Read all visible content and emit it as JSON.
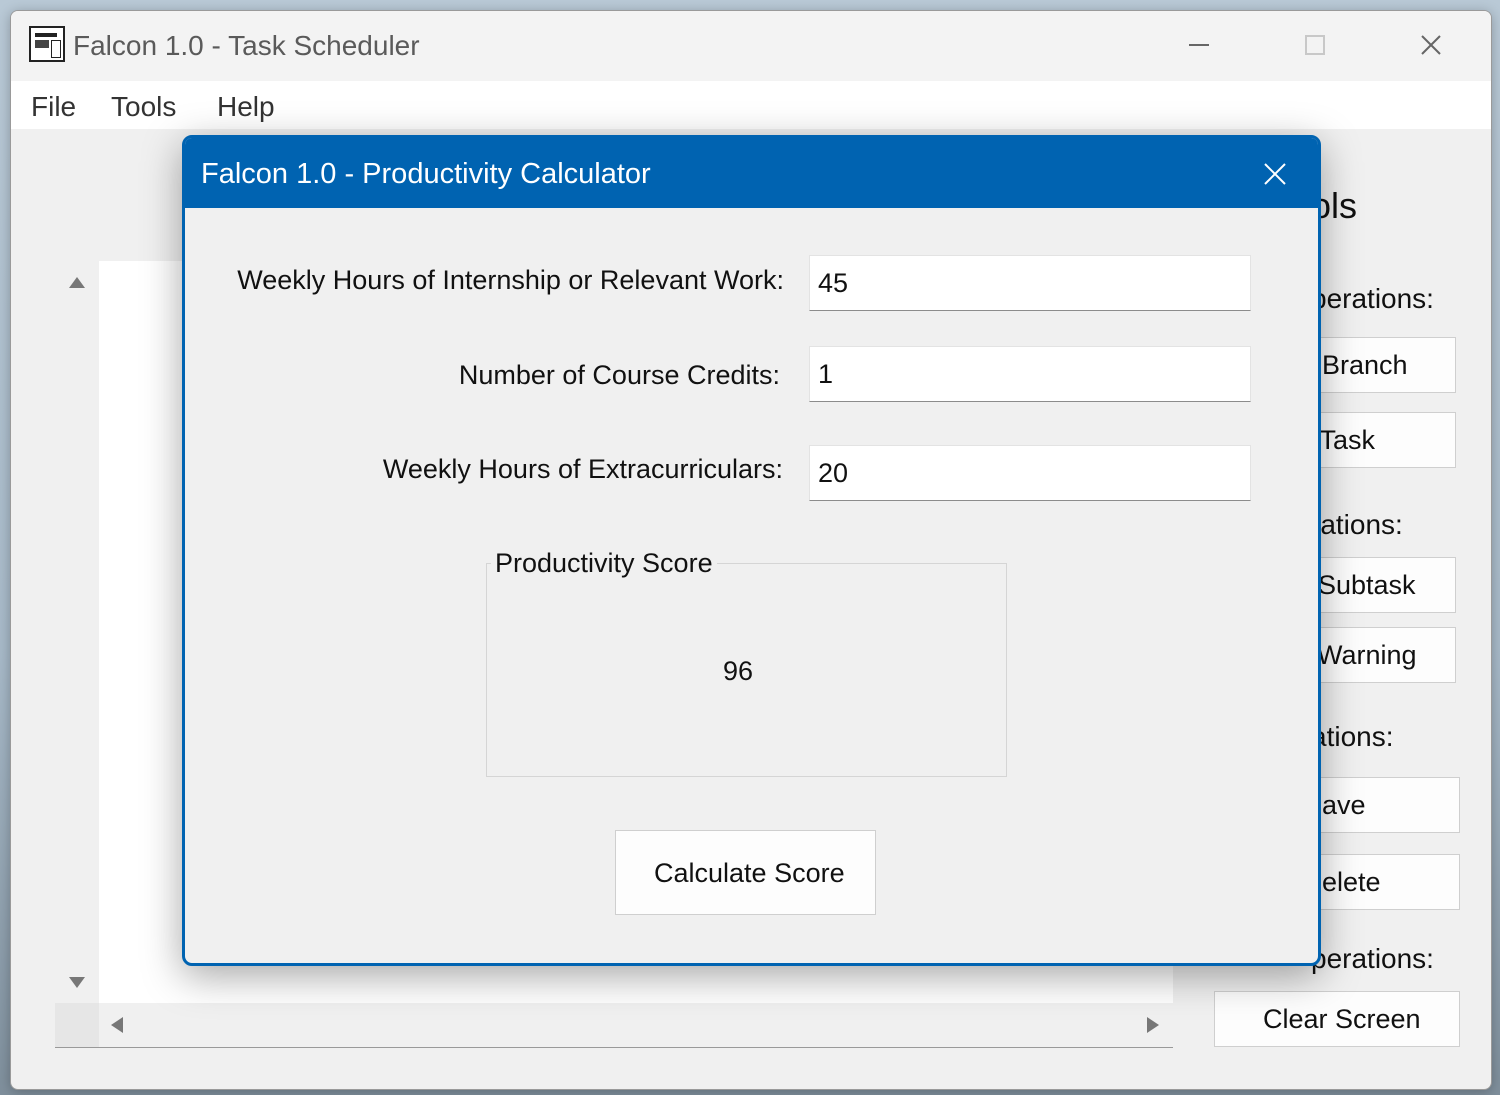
{
  "main_window": {
    "title": "Falcon 1.0 - Task Scheduler",
    "menu": [
      "File",
      "Tools",
      "Help"
    ]
  },
  "right_panel": {
    "heading_fragment": "ols",
    "section_1_fragment": "perations:",
    "buttons_1": [
      "Branch",
      "/ Task"
    ],
    "section_2_fragment": "rations:",
    "buttons_2": [
      "Subtask",
      "Warning"
    ],
    "section_3_fragment": "ations:",
    "buttons_3": [
      "ave",
      "elete"
    ],
    "section_4_fragment": "perations:",
    "clear_screen": "Clear Screen"
  },
  "dialog": {
    "title": "Falcon 1.0 - Productivity Calculator",
    "fields": [
      {
        "label": "Weekly Hours of Internship or Relevant Work:",
        "value": "45"
      },
      {
        "label": "Number of Course Credits:",
        "value": "1"
      },
      {
        "label": "Weekly Hours of Extracurriculars:",
        "value": "20"
      }
    ],
    "score_group_label": "Productivity Score",
    "score_value": "96",
    "calculate_button": "Calculate Score"
  },
  "icons": {
    "app": "falcon-app-icon",
    "minimize": "minimize-icon",
    "maximize": "maximize-icon",
    "close": "close-icon"
  },
  "colors": {
    "dialog_accent": "#0063b1",
    "window_bg": "#f0f0f0"
  }
}
